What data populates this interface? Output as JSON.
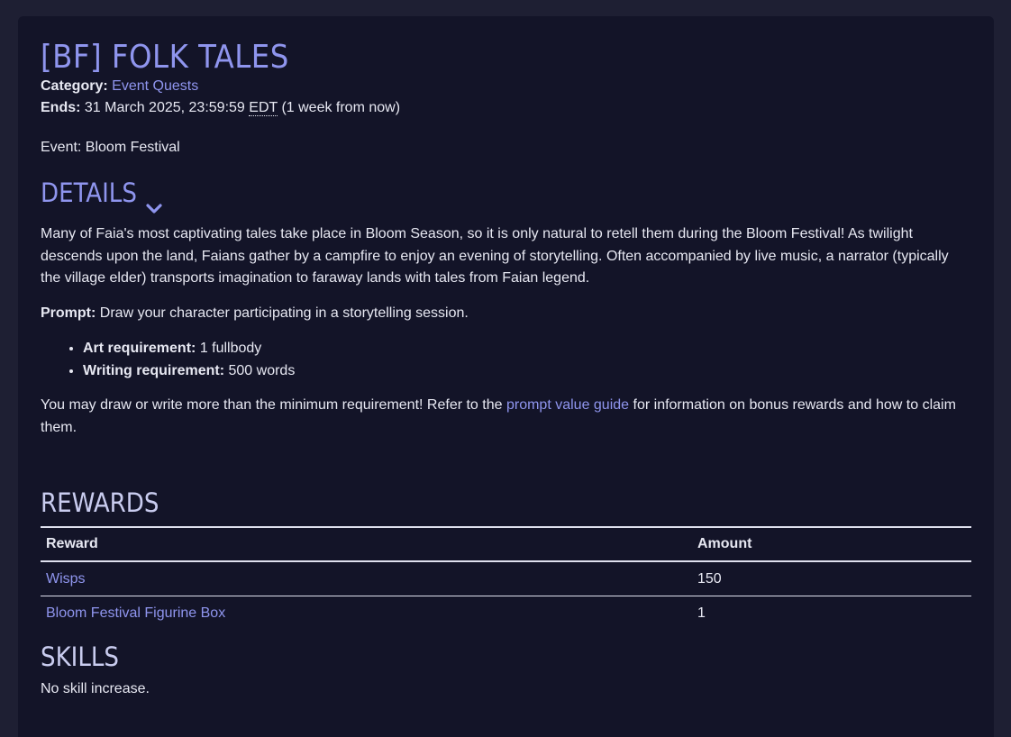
{
  "quest": {
    "title": "[BF] FOLK TALES",
    "category_label": "Category:",
    "category_value": "Event Quests",
    "ends_label": "Ends:",
    "ends_date": "31 March 2025, 23:59:59",
    "ends_tz": "EDT",
    "ends_relative": "(1 week from now)",
    "event_line": "Event: Bloom Festival"
  },
  "details": {
    "heading": "DETAILS",
    "toggle_icon": "chevron-down-icon",
    "description": "Many of Faia's most captivating tales take place in Bloom Season, so it is only natural to retell them during the Bloom Festival! As twilight descends upon the land, Faians gather by a campfire to enjoy an evening of storytelling. Often accompanied by live music, a narrator (typically the village elder) transports imagination to faraway lands with tales from Faian legend.",
    "prompt_label": "Prompt:",
    "prompt_text": "Draw your character participating in a storytelling session.",
    "requirements": [
      {
        "label": "Art requirement:",
        "value": "1 fullbody"
      },
      {
        "label": "Writing requirement:",
        "value": "500 words"
      }
    ],
    "note_before": "You may draw or write more than the minimum requirement! Refer to the",
    "note_link": "prompt value guide",
    "note_after": "for information on bonus rewards and how to claim them."
  },
  "rewards": {
    "heading": "REWARDS",
    "columns": [
      "Reward",
      "Amount"
    ],
    "rows": [
      {
        "reward": "Wisps",
        "amount": "150"
      },
      {
        "reward": "Bloom Festival Figurine Box",
        "amount": "1"
      }
    ]
  },
  "skills": {
    "heading": "SKILLS",
    "text": "No skill increase."
  },
  "colors": {
    "page_bg": "#1e1f33",
    "card_bg": "#131428",
    "accent": "#8f95ee",
    "text": "#e7e8f2"
  }
}
